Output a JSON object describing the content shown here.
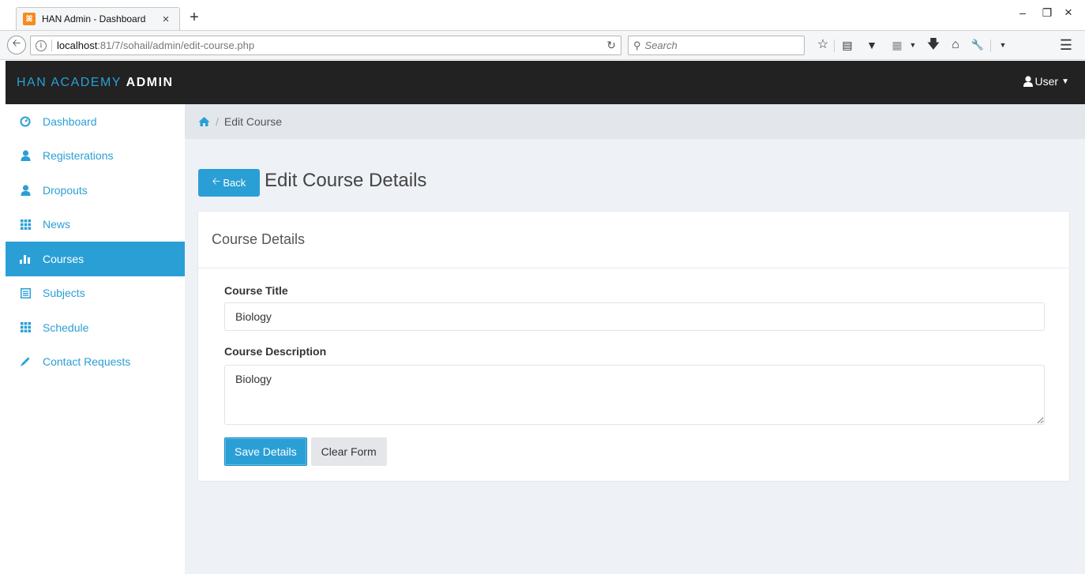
{
  "browser": {
    "tab_title": "HAN Admin - Dashboard",
    "tab_close": "×",
    "new_tab": "+",
    "url_host": "localhost",
    "url_path": ":81/7/sohail/admin/edit-course.php",
    "search_placeholder": "Search",
    "window_controls": [
      "–",
      "❐",
      "×"
    ]
  },
  "header": {
    "brand_main": "HAN ACADEMY",
    "brand_suffix": "ADMIN",
    "user_label": "User"
  },
  "sidebar": {
    "items": [
      {
        "label": "Dashboard",
        "icon": "dashboard-icon",
        "active": false
      },
      {
        "label": "Registerations",
        "icon": "user-icon",
        "active": false
      },
      {
        "label": "Dropouts",
        "icon": "user-icon",
        "active": false
      },
      {
        "label": "News",
        "icon": "grid-icon",
        "active": false
      },
      {
        "label": "Courses",
        "icon": "bar-chart-icon",
        "active": true
      },
      {
        "label": "Subjects",
        "icon": "list-alt-icon",
        "active": false
      },
      {
        "label": "Schedule",
        "icon": "grid-icon",
        "active": false
      },
      {
        "label": "Contact Requests",
        "icon": "pencil-icon",
        "active": false
      }
    ]
  },
  "breadcrumb": {
    "separator": "/",
    "current": "Edit Course"
  },
  "page": {
    "back_label": "Back",
    "title": "Edit Course Details"
  },
  "panel": {
    "heading": "Course Details",
    "course_title_label": "Course Title",
    "course_title_value": "Biology",
    "course_description_label": "Course Description",
    "course_description_value": "Biology",
    "save_label": "Save Details",
    "clear_label": "Clear Form"
  },
  "colors": {
    "accent": "#2a9fd6",
    "header_bg": "#222222",
    "main_bg": "#eef1f5",
    "breadcrumb_bg": "#e3e7ec"
  }
}
